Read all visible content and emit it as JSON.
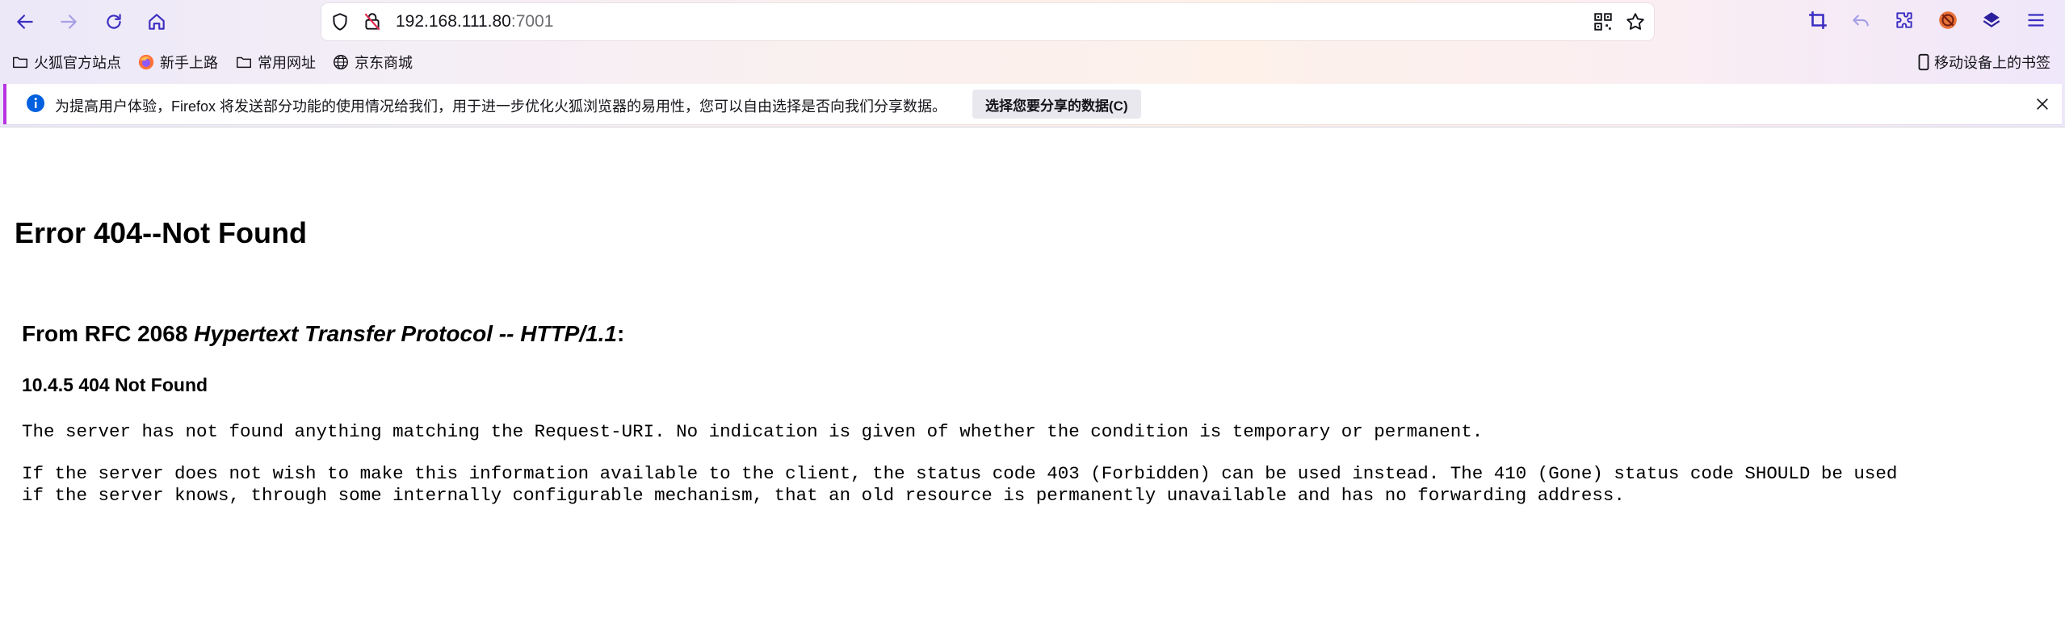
{
  "browser": {
    "url_host": "192.168.111.80",
    "url_port": ":7001",
    "bookmarks": [
      {
        "label": "火狐官方站点",
        "icon": "folder-icon"
      },
      {
        "label": "新手上路",
        "icon": "firefox-icon"
      },
      {
        "label": "常用网址",
        "icon": "folder-icon"
      },
      {
        "label": "京东商城",
        "icon": "globe-icon"
      }
    ],
    "mobile_bookmarks": "移动设备上的书签",
    "accent_color": "#b833e1"
  },
  "notification": {
    "message": "为提高用户体验，Firefox 将发送部分功能的使用情况给我们，用于进一步优化火狐浏览器的易用性，您可以自由选择是否向我们分享数据。",
    "button_label": "选择您要分享的数据(C)"
  },
  "page": {
    "title": "Error 404--Not Found",
    "rfc_prefix": "From RFC 2068 ",
    "rfc_title": "Hypertext Transfer Protocol -- HTTP/1.1",
    "rfc_suffix": ":",
    "section": "10.4.5 404 Not Found",
    "para1": "The server has not found anything matching the Request-URI. No indication is given of whether the condition is temporary or permanent.",
    "para2_line1": "If the server does not wish to make this information available to the client, the status code 403 (Forbidden) can be used instead. The 410 (Gone) status code SHOULD be used",
    "para2_line2": "if the server knows, through some internally configurable mechanism, that an old resource is permanently unavailable and has no forwarding address."
  }
}
